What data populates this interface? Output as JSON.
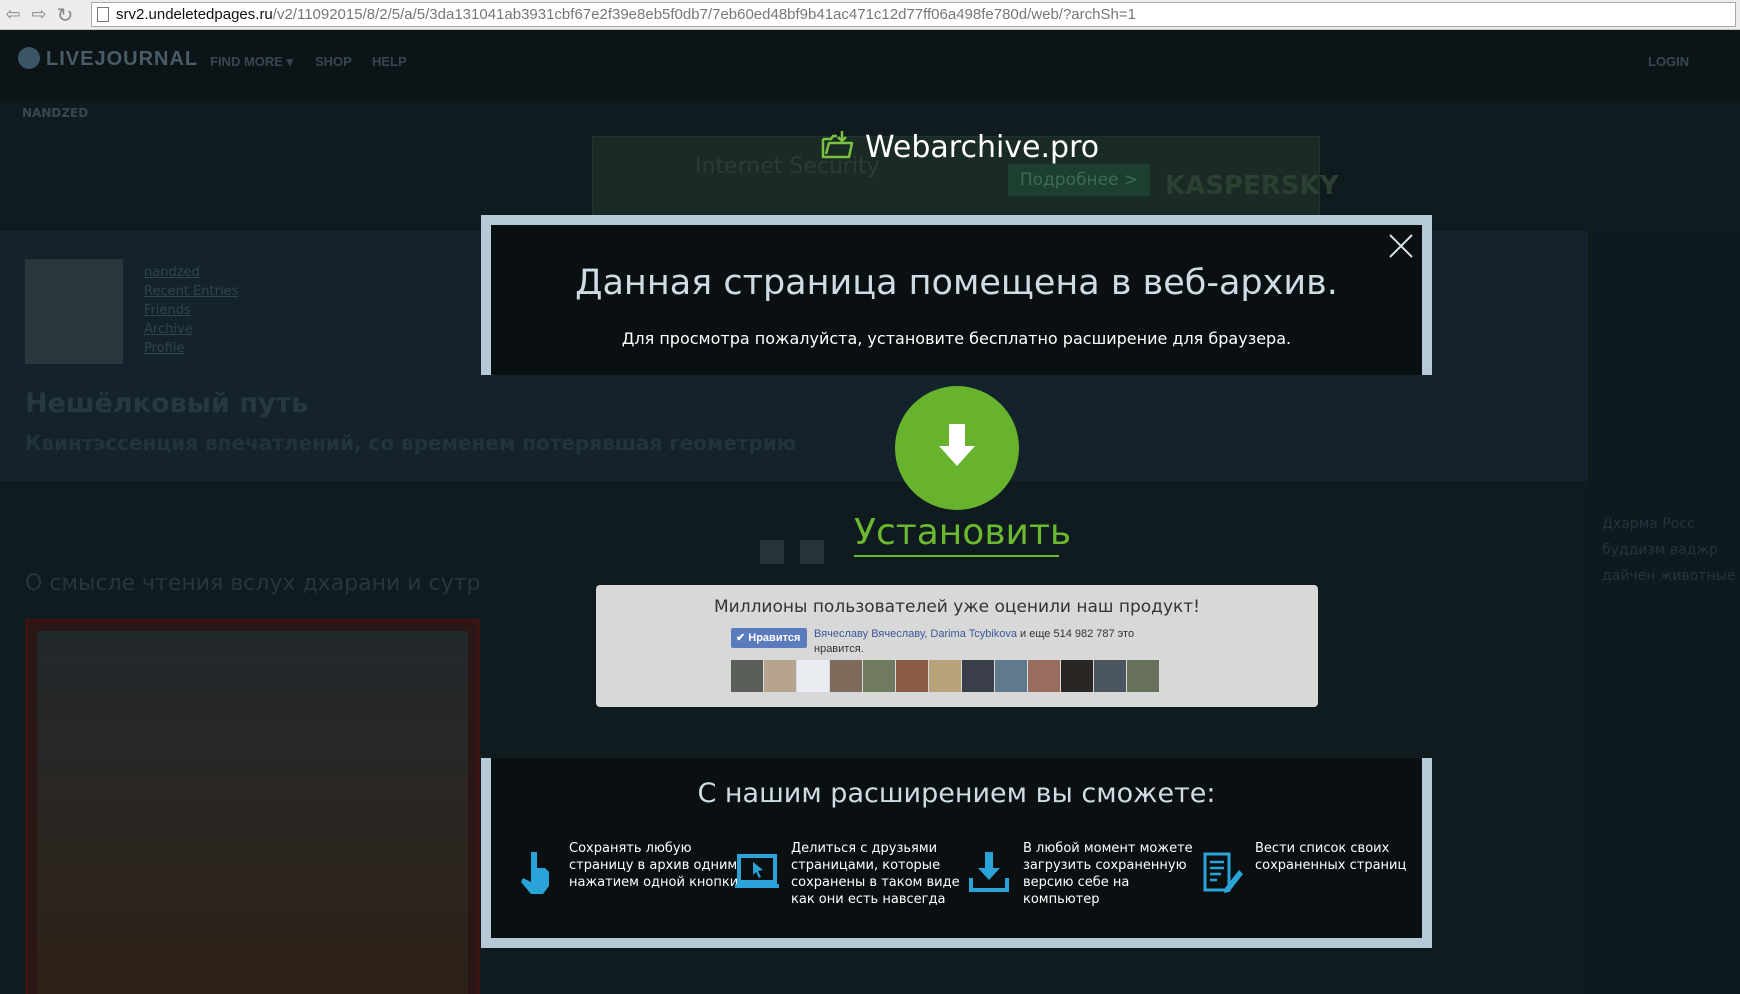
{
  "browser": {
    "url_host": "srv2.undeletedpages.ru",
    "url_path": "/v2/11092015/8/2/5/a/5/3da131041ab3931cbf67e2f39e8eb5f0db7/7eb60ed48bf9b41ac471c12d77ff06a498fe780d/web/?archSh=1"
  },
  "background_page": {
    "logo": "LIVEJOURNAL",
    "nav": [
      "FIND MORE ▾",
      "SHOP",
      "HELP"
    ],
    "login": "LOGIN",
    "username": "NANDZED",
    "ad": {
      "product": "Internet Security",
      "button": "Подробнее >",
      "brand": "KASPERSKY"
    },
    "sidebar_links": [
      "nandzed",
      "Recent Entries",
      "Friends",
      "Archive",
      "Profile"
    ],
    "blog_title": "Нешёлковый путь",
    "blog_subtitle": "Квинтэссенция впечатлений, со временем потерявшая геометрию",
    "post_title": "О смысле чтения вслух дхарани и сутр",
    "tags": [
      "Дхарма Росс",
      "буддизм ваджр",
      "дайчен животные"
    ]
  },
  "modal": {
    "brand": "Webarchive.pro",
    "title": "Данная страница помещена в веб-архив.",
    "subtitle": "Для просмотра пожалуйста, установите бесплатно расширение для браузера.",
    "install_label": "Установить",
    "social": {
      "title": "Миллионы пользователей уже оценили наш продукт!",
      "like_button": "✔ Нравится",
      "liked_names": "Вячеславу Вячеславу, Darima Tcybikova",
      "liked_rest": " и еще 514 982 787 это нравится."
    },
    "features_title": "С нашим расширением вы сможете:",
    "features": [
      {
        "icon": "hand-pointer-icon",
        "text": "Сохранять любую страницу в архив одним нажатием одной кнопки"
      },
      {
        "icon": "laptop-cursor-icon",
        "text": "Делиться с друзьями страницами, которые сохранены в таком виде как они есть навсегда"
      },
      {
        "icon": "download-arrow-icon",
        "text": "В любой момент можете загрузить сохраненную версию себе на компьютер"
      },
      {
        "icon": "document-list-icon",
        "text": "Вести список своих сохраненных страниц"
      }
    ]
  },
  "colors": {
    "accent_green": "#67b32e",
    "modal_border": "#b6c9d6",
    "feature_icon": "#2aa4d8"
  }
}
